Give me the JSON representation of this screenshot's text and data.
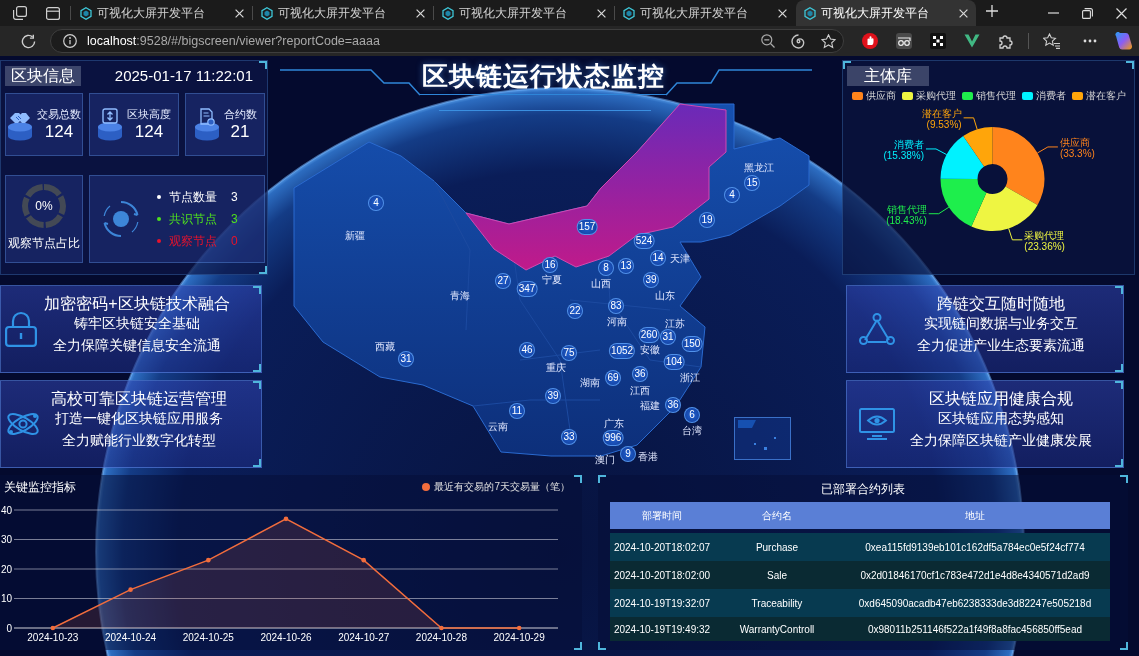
{
  "browser": {
    "tabs": [
      {
        "title": "可视化大屏开发平台",
        "selected": false
      },
      {
        "title": "可视化大屏开发平台",
        "selected": false
      },
      {
        "title": "可视化大屏开发平台",
        "selected": false
      },
      {
        "title": "可视化大屏开发平台",
        "selected": false
      },
      {
        "title": "可视化大屏开发平台",
        "selected": true
      }
    ],
    "address": {
      "host": "localhost",
      "path": ":9528/#/bigscreen/viewer?reportCode=aaaa"
    }
  },
  "block_info": {
    "title": "区块信息",
    "datetime": "2025-01-17 11:22:01",
    "stats": [
      {
        "kind": "transactions",
        "label": "交易总数",
        "value": "124"
      },
      {
        "kind": "height",
        "label": "区块高度",
        "value": "124"
      },
      {
        "kind": "contracts",
        "label": "合约数",
        "value": "21"
      }
    ],
    "observer_ratio": {
      "reading": "0%",
      "label": "观察节点占比"
    },
    "nodes": [
      {
        "label": "节点数量",
        "count": "3",
        "color": "#ffffff"
      },
      {
        "label": "共识节点",
        "count": "3",
        "color": "#4fe01e"
      },
      {
        "label": "观察节点",
        "count": "0",
        "color": "#e8122c"
      }
    ]
  },
  "left_features": [
    {
      "kind": "lock",
      "title": "加密密码+区块链技术融合",
      "lines": [
        "铸牢区块链安全基础",
        "全力保障关键信息安全流通"
      ]
    },
    {
      "kind": "atom",
      "title": "高校可靠区块链运营管理",
      "lines": [
        "打造一键化区块链应用服务",
        "全力赋能行业数字化转型"
      ]
    }
  ],
  "header": {
    "title": "区块链运行状态监控"
  },
  "map": {
    "region_labels": [
      "新疆",
      "黑龙江",
      "天津",
      "宁夏",
      "山西",
      "山东",
      "青海",
      "河南",
      "江苏",
      "安徽",
      "重庆",
      "浙江",
      "西藏",
      "湖南",
      "江西",
      "福建",
      "台湾",
      "云南",
      "广东",
      "香港",
      "澳门"
    ],
    "markers": [
      "4",
      "15",
      "4",
      "19",
      "157",
      "524",
      "14",
      "16",
      "8",
      "13",
      "39",
      "27",
      "347",
      "22",
      "83",
      "260",
      "31",
      "150",
      "46",
      "75",
      "1052",
      "104",
      "31",
      "36",
      "69",
      "39",
      "36",
      "6",
      "11",
      "33",
      "996",
      "9"
    ]
  },
  "subject_library": {
    "title": "主体库",
    "legend": [
      {
        "label": "供应商",
        "color": "#ff841c"
      },
      {
        "label": "采购代理",
        "color": "#eef542"
      },
      {
        "label": "销售代理",
        "color": "#1eee4c"
      },
      {
        "label": "消费者",
        "color": "#00f2ff"
      },
      {
        "label": "潜在客户",
        "color": "#ffa50a"
      }
    ],
    "chart_data": {
      "type": "donut",
      "categories": [
        "供应商",
        "采购代理",
        "销售代理",
        "消费者",
        "潜在客户"
      ],
      "values": [
        33.3,
        23.36,
        18.43,
        15.38,
        9.53
      ],
      "value_labels": [
        "(33.3%)",
        "(23.36%)",
        "(18.43%)",
        "(15.38%)",
        "(9.53%)"
      ]
    }
  },
  "right_features": [
    {
      "kind": "network",
      "title": "跨链交互随时随地",
      "lines": [
        "实现链间数据与业务交互",
        "全力促进产业生态要素流通"
      ]
    },
    {
      "kind": "monitor",
      "title": "区块链应用健康合规",
      "lines": [
        "区块链应用态势感知",
        "全力保障区块链产业健康发展"
      ]
    }
  ],
  "monitor_chart": {
    "title": "关键监控指标",
    "chart_data": {
      "type": "area",
      "categories": [
        "2024-10-23",
        "2024-10-24",
        "2024-10-25",
        "2024-10-26",
        "2024-10-27",
        "2024-10-28",
        "2024-10-29"
      ],
      "series": [
        {
          "name": "最近有交易的7天交易量（笔）",
          "color": "#f26d3d",
          "values": [
            0,
            13,
            23,
            37,
            23,
            0,
            0
          ]
        }
      ],
      "ylim": [
        0,
        40
      ],
      "yticks": [
        0,
        10,
        20,
        30,
        40
      ],
      "grid": true
    }
  },
  "contracts": {
    "title": "已部署合约列表",
    "columns": [
      "部署时间",
      "合约名",
      "地址"
    ],
    "rows": [
      [
        "2024-10-20T18:02:07",
        "Purchase",
        "0xea115fd9139eb101c162df5a784ec0e5f24cf774"
      ],
      [
        "2024-10-20T18:02:00",
        "Sale",
        "0x2d01846170cf1c783e472d1e4d8e4340571d2ad9"
      ],
      [
        "2024-10-19T19:32:07",
        "Traceability",
        "0xd645090acadb47eb6238333de3d82247e505218d"
      ],
      [
        "2024-10-19T19:49:32",
        "WarrantyControll",
        "0x98011b251146f522a1f49f8a8fac456850ff5ead"
      ]
    ]
  }
}
